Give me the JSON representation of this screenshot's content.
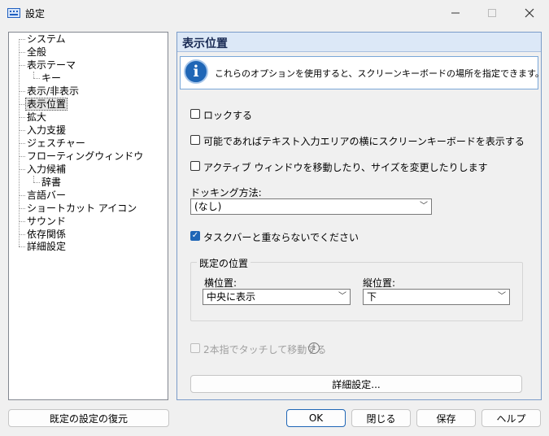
{
  "window": {
    "title": "設定"
  },
  "tree": {
    "items": [
      {
        "label": "システム"
      },
      {
        "label": "全般"
      },
      {
        "label": "表示テーマ"
      },
      {
        "label": "キー"
      },
      {
        "label": "表示/非表示"
      },
      {
        "label": "表示位置"
      },
      {
        "label": "拡大"
      },
      {
        "label": "入力支援"
      },
      {
        "label": "ジェスチャー"
      },
      {
        "label": "フローティングウィンドウ"
      },
      {
        "label": "入力候補"
      },
      {
        "label": "辞書"
      },
      {
        "label": "言語バー"
      },
      {
        "label": "ショートカット アイコン"
      },
      {
        "label": "サウンド"
      },
      {
        "label": "依存関係"
      },
      {
        "label": "詳細設定"
      }
    ]
  },
  "panel": {
    "title": "表示位置",
    "info_text": "これらのオプションを使用すると、スクリーンキーボードの場所を指定できます。",
    "options": {
      "lock": "ロックする",
      "beside_text": "可能であればテキスト入力エリアの横にスクリーンキーボードを表示する",
      "active_window": "アクティブ ウィンドウを移動したり、サイズを変更したりします",
      "taskbar": "タスクバーと重ならないでください",
      "two_finger": "2本指でタッチして移動する"
    },
    "docking": {
      "label": "ドッキング方法:",
      "value": "(なし)"
    },
    "default_position": {
      "label": "既定の位置",
      "horizontal_label": "横位置:",
      "horizontal_value": "中央に表示",
      "vertical_label": "縦位置:",
      "vertical_value": "下"
    },
    "advanced_button": "詳細設定..."
  },
  "footer": {
    "restore": "既定の設定の復元",
    "ok": "OK",
    "close": "閉じる",
    "save": "保存",
    "help": "ヘルプ"
  },
  "icons": {
    "minimize": "minimize-icon",
    "maximize": "maximize-icon",
    "close": "close-icon",
    "info": "info-icon",
    "dropdown": "chevron-down-icon"
  },
  "colors": {
    "accent": "#1f66b6",
    "panel_header": "#dce8f7"
  }
}
